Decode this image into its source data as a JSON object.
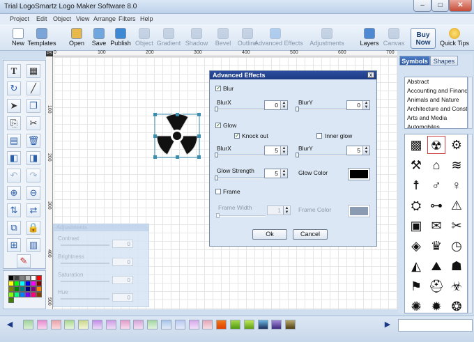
{
  "window": {
    "title": "Trial LogoSmartz Logo Maker Software 8.0",
    "min": "–",
    "max": "□",
    "close": "✕"
  },
  "menu": [
    "Project",
    "Edit",
    "Object",
    "View",
    "Arrange",
    "Filters",
    "Help"
  ],
  "toolbar": [
    {
      "label": "New",
      "color": "#ffffff",
      "enabled": true
    },
    {
      "label": "Templates",
      "color": "#7ba4d8",
      "enabled": true
    },
    {
      "label": "Open",
      "color": "#e9b84a",
      "enabled": true
    },
    {
      "label": "Save",
      "color": "#6fa6e0",
      "enabled": true
    },
    {
      "label": "Publish",
      "color": "#3f88d4",
      "enabled": true
    },
    {
      "label": "Object",
      "color": "#9cb2cc",
      "enabled": false
    },
    {
      "label": "Gradient",
      "color": "#9cb2cc",
      "enabled": false
    },
    {
      "label": "Shadow",
      "color": "#9cb2cc",
      "enabled": false
    },
    {
      "label": "Bevel",
      "color": "#9cb2cc",
      "enabled": false
    },
    {
      "label": "Outline",
      "color": "#9cb2cc",
      "enabled": false
    },
    {
      "label": "Advanced Effects",
      "color": "#6ea6e4",
      "enabled": false
    },
    {
      "label": "Adjustments",
      "color": "#9cb2cc",
      "enabled": false
    },
    {
      "label": "Layers",
      "color": "#4f89d3",
      "enabled": true
    },
    {
      "label": "Canvas",
      "color": "#9cb2cc",
      "enabled": false
    }
  ],
  "buy_now": "Buy Now",
  "quick_tips": "Quick Tips",
  "ruler": {
    "corner": "PS",
    "h": [
      "0",
      "100",
      "200",
      "300",
      "400",
      "500",
      "600",
      "700"
    ],
    "v": [
      "100",
      "200",
      "300",
      "400",
      "500"
    ]
  },
  "adjustments": {
    "title": "Adjustments",
    "rows": [
      {
        "label": "Contrast",
        "value": "0"
      },
      {
        "label": "Brightness",
        "value": "0"
      },
      {
        "label": "Saturation",
        "value": "0"
      },
      {
        "label": "Hue",
        "value": "0"
      }
    ]
  },
  "dialog": {
    "title": "Advanced Effects",
    "close": "x",
    "blur_label": "Blur",
    "blurx_label": "BlurX",
    "blurx": "0",
    "blury_label": "BlurY",
    "blury": "0",
    "glow_label": "Glow",
    "knockout_label": "Knock out",
    "innerglow_label": "Inner glow",
    "glowx_label": "BlurX",
    "glowx": "5",
    "glowy_label": "BlurY",
    "glowy": "5",
    "strength_label": "Glow Strength",
    "strength": "5",
    "glowcolor_label": "Glow Color",
    "glow_color": "#000000",
    "frame_label": "Frame",
    "framewidth_label": "Frame Width",
    "framewidth": "1",
    "framecolor_label": "Frame Color",
    "frame_color": "#8a9bb2",
    "ok": "Ok",
    "cancel": "Cancel"
  },
  "right": {
    "tab_symbols": "Symbols",
    "tab_shapes": "Shapes",
    "categories": [
      "Abstract",
      "Accounting and Finance",
      "Animals and Nature",
      "Architecture and Construction",
      "Arts and Media",
      "Automobiles"
    ]
  },
  "gradients": [
    [
      "#9fd39a",
      "#d8f0d2"
    ],
    [
      "#e88ad0",
      "#fbd5ef"
    ],
    [
      "#e8a1a8",
      "#fbdadd"
    ],
    [
      "#a8d88e",
      "#e7f6dc"
    ],
    [
      "#c9d68c",
      "#f3f7d6"
    ],
    [
      "#c28de4",
      "#eedbf9"
    ],
    [
      "#cc9be3",
      "#f0ddf8"
    ],
    [
      "#e29cc8",
      "#f9dcef"
    ],
    [
      "#d6a3d6",
      "#f5def5"
    ],
    [
      "#a3d7a0",
      "#e2f4df"
    ],
    [
      "#a6c5e9",
      "#e2ecf9"
    ],
    [
      "#b9c8f0",
      "#e6ecfb"
    ],
    [
      "#d7a7e8",
      "#f3e0fa"
    ],
    [
      "#e3a6b8",
      "#f8dee6"
    ],
    [
      "#f07a1a",
      "#e04000"
    ],
    [
      "#a3d84c",
      "#4f9a10"
    ],
    [
      "#bfe85a",
      "#5f9d14"
    ],
    [
      "#6ab4e0",
      "#1a2f5a"
    ],
    [
      "#a48ad8",
      "#3f2a80"
    ],
    [
      "#b9a86a",
      "#4f3f14"
    ]
  ],
  "colors": [
    "#000000",
    "#404040",
    "#808080",
    "#c0c0c0",
    "#ffffff",
    "#ff0000",
    "#ffff00",
    "#00ff00",
    "#00ffff",
    "#0000ff",
    "#ff00ff",
    "#800000",
    "#808000",
    "#008000",
    "#008080",
    "#000080",
    "#800080",
    "#ff8000",
    "#80ff00",
    "#00ff80",
    "#0080ff",
    "#8000ff",
    "#ff0080",
    "#804000",
    "#408000"
  ]
}
